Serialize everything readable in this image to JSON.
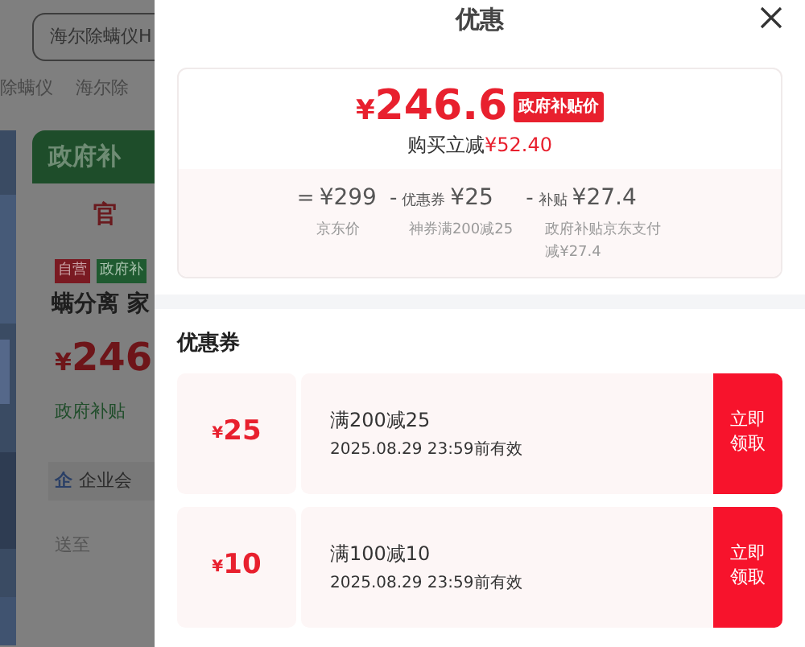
{
  "background_page": {
    "search_value": "海尔除螨仪H",
    "links": [
      "除螨仪",
      "海尔除"
    ],
    "banner": "政府补",
    "badge": "官",
    "tags": [
      {
        "label": "自营",
        "color": "#7a1a22"
      },
      {
        "label": "政府补",
        "color": "#1f5a30"
      }
    ],
    "title": "螨分离 家",
    "price": {
      "currency": "¥",
      "amount": "246"
    },
    "subsidy": "政府补贴",
    "member_mark": "企",
    "member": "企业会",
    "ship_to": "送至"
  },
  "sheet": {
    "title": "优惠",
    "summary": {
      "price": {
        "currency": "¥",
        "amount": "246.6"
      },
      "tag": "政府补贴价",
      "saving_label": "购买立减",
      "saving": "¥52.40",
      "breakdown": [
        {
          "operator": "=",
          "amount": "¥299",
          "note": "京东价"
        },
        {
          "operator": "-",
          "label": "优惠券",
          "amount": "¥25",
          "note": "神券满200减25"
        },
        {
          "operator": "-",
          "label": "补贴",
          "amount": "¥27.4",
          "note": "政府补贴京东支付减¥27.4"
        }
      ]
    },
    "coupons_title": "优惠券",
    "coupons": [
      {
        "currency": "¥",
        "amount": "25",
        "condition": "满200减25",
        "validity": "2025.08.29 23:59前有效",
        "action": "立即领取"
      },
      {
        "currency": "¥",
        "amount": "10",
        "condition": "满100减10",
        "validity": "2025.08.29 23:59前有效",
        "action": "立即领取"
      }
    ]
  }
}
